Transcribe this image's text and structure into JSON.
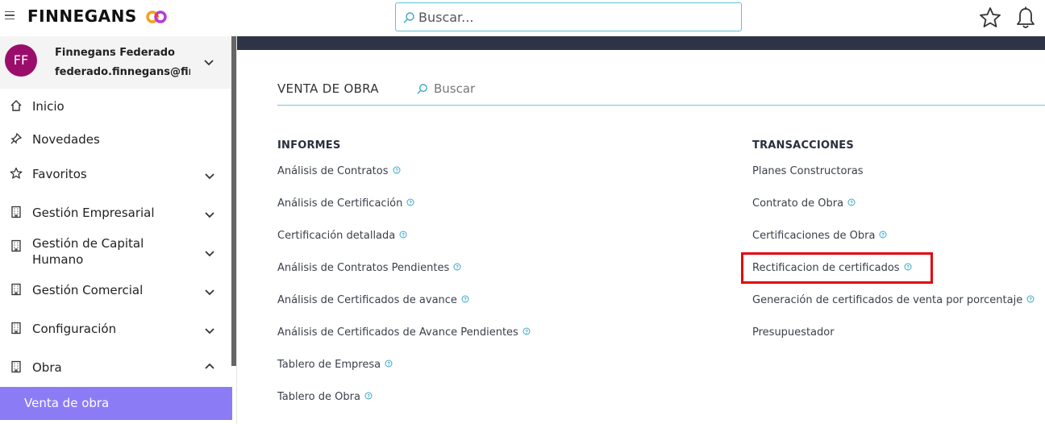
{
  "header": {
    "brand": "FINNEGANS",
    "search_placeholder": "Buscar..."
  },
  "user": {
    "initials": "FF",
    "name": "Finnegans Federado",
    "email": "federado.finnegans@fin..."
  },
  "sidebar": {
    "items": [
      {
        "label": "Inicio",
        "icon": "home-icon"
      },
      {
        "label": "Novedades",
        "icon": "pin-icon"
      },
      {
        "label": "Favoritos",
        "icon": "star-icon"
      },
      {
        "label": "Gestión Empresarial",
        "icon": "building-icon"
      },
      {
        "label": "Gestión de Capital Humano",
        "icon": "building-icon"
      },
      {
        "label": "Gestión Comercial",
        "icon": "building-icon"
      },
      {
        "label": "Configuración",
        "icon": "building-icon"
      },
      {
        "label": "Obra",
        "icon": "building-icon"
      }
    ],
    "active_sub": "Venta de obra"
  },
  "main": {
    "title": "VENTA DE OBRA",
    "search_placeholder": "Buscar",
    "informes": {
      "heading": "INFORMES",
      "links": [
        "Análisis de Contratos",
        "Análisis de Certificación",
        "Certificación detallada",
        "Análisis de Contratos Pendientes",
        "Análisis de Certificados de avance",
        "Análisis de Certificados de Avance Pendientes",
        "Tablero de Empresa",
        "Tablero de Obra"
      ]
    },
    "transacciones": {
      "heading": "TRANSACCIONES",
      "links": [
        "Planes Constructoras",
        "Contrato de Obra",
        "Certificaciones de Obra",
        "Rectificacion de certificados",
        "Generación de certificados de venta por porcentaje",
        "Presupuestador"
      ]
    }
  },
  "colors": {
    "accent": "#5ec3d6",
    "avatar": "#9b0d6b",
    "active_nav": "#8b7cf6",
    "highlight": "#e3060f",
    "band": "#2e3446"
  }
}
